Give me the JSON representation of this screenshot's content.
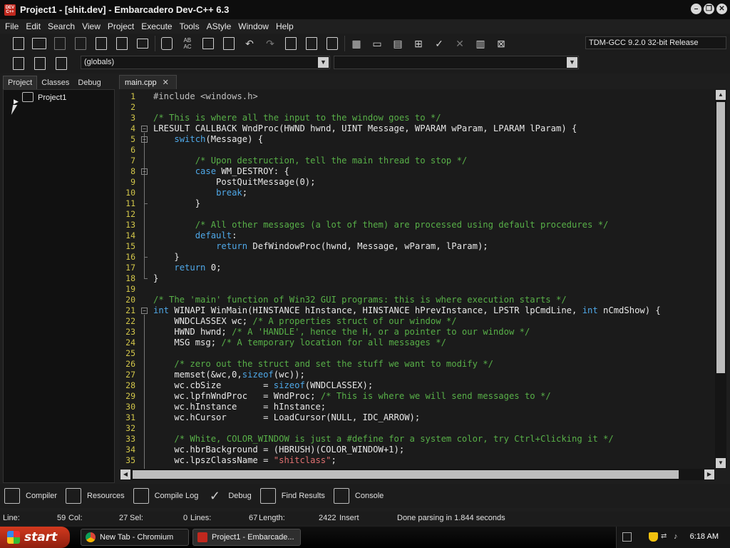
{
  "window": {
    "title": "Project1 - [shit.dev] - Embarcadero Dev-C++ 6.3",
    "app_icon_text": "DEV C++",
    "buttons": [
      "minimize",
      "restore",
      "close"
    ]
  },
  "menu": [
    "File",
    "Edit",
    "Search",
    "View",
    "Project",
    "Execute",
    "Tools",
    "AStyle",
    "Window",
    "Help"
  ],
  "toolbar": {
    "compiler": "TDM-GCC 9.2.0 32-bit Release",
    "scope": "(globals)",
    "icons": [
      "new-file-icon",
      "open-icon",
      "save-icon",
      "save-all-icon",
      "close-icon",
      "close-all-icon",
      "print-icon",
      "find-icon",
      "replace-icon",
      "goto-icon",
      "bookmark-icon",
      "undo-icon",
      "redo-icon",
      "indent-icon",
      "unindent-icon",
      "toggle-comment-icon",
      "compile-icon",
      "run-icon",
      "compile-run-icon",
      "rebuild-icon",
      "syntax-check-icon",
      "stop-icon",
      "chart-icon",
      "clean-icon"
    ]
  },
  "left_panel": {
    "tabs": [
      "Project",
      "Classes",
      "Debug"
    ],
    "active_tab": "Project",
    "tree_root": "Project1"
  },
  "editor": {
    "tab_label": "main.cpp",
    "lines": [
      "#include <windows.h>",
      "",
      "/* This is where all the input to the window goes to */",
      "LRESULT CALLBACK WndProc(HWND hwnd, UINT Message, WPARAM wParam, LPARAM lParam) {",
      "    switch(Message) {",
      "",
      "        /* Upon destruction, tell the main thread to stop */",
      "        case WM_DESTROY: {",
      "            PostQuitMessage(0);",
      "            break;",
      "        }",
      "",
      "        /* All other messages (a lot of them) are processed using default procedures */",
      "        default:",
      "            return DefWindowProc(hwnd, Message, wParam, lParam);",
      "    }",
      "    return 0;",
      "}",
      "",
      "/* The 'main' function of Win32 GUI programs: this is where execution starts */",
      "int WINAPI WinMain(HINSTANCE hInstance, HINSTANCE hPrevInstance, LPSTR lpCmdLine, int nCmdShow) {",
      "    WNDCLASSEX wc; /* A properties struct of our window */",
      "    HWND hwnd; /* A 'HANDLE', hence the H, or a pointer to our window */",
      "    MSG msg; /* A temporary location for all messages */",
      "",
      "    /* zero out the struct and set the stuff we want to modify */",
      "    memset(&wc,0,sizeof(wc));",
      "    wc.cbSize        = sizeof(WNDCLASSEX);",
      "    wc.lpfnWndProc   = WndProc; /* This is where we will send messages to */",
      "    wc.hInstance     = hInstance;",
      "    wc.hCursor       = LoadCursor(NULL, IDC_ARROW);",
      "",
      "    /* White, COLOR_WINDOW is just a #define for a system color, try Ctrl+Clicking it */",
      "    wc.hbrBackground = (HBRUSH)(COLOR_WINDOW+1);",
      "    wc.lpszClassName = \"shitclass\";"
    ]
  },
  "bottom_tabs": [
    {
      "label": "Compiler",
      "icon": "compiler-icon"
    },
    {
      "label": "Resources",
      "icon": "resources-icon"
    },
    {
      "label": "Compile Log",
      "icon": "compile-log-icon"
    },
    {
      "label": "Debug",
      "icon": "debug-check-icon"
    },
    {
      "label": "Find Results",
      "icon": "find-results-icon"
    },
    {
      "label": "Console",
      "icon": "console-icon"
    }
  ],
  "status": {
    "line_label": "Line:",
    "line_value": "59",
    "col_label": "Col:",
    "col_value": "27",
    "sel_label": "Sel:",
    "sel_value": "0",
    "lines_label": "Lines:",
    "lines_value": "67",
    "length_label": "Length:",
    "length_value": "2422",
    "mode": "Insert",
    "message": "Done parsing in 1.844 seconds"
  },
  "taskbar": {
    "start_label": "start",
    "tasks": [
      "New Tab - Chromium",
      "Project1 - Embarcade..."
    ],
    "clock": "6:18 AM"
  },
  "colors": {
    "keyword": "#4fa8e8",
    "comment": "#58b048",
    "string": "#e07070",
    "line_number": "#d2c64a",
    "background": "#1b1b1b"
  }
}
